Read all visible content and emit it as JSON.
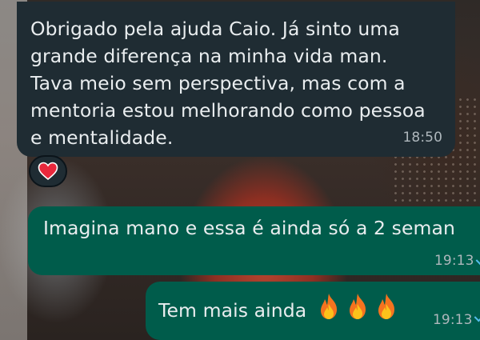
{
  "messages": [
    {
      "direction": "incoming",
      "text": "Obrigado pela ajuda Caio. Já sinto uma grande diferença na minha vida man. Tava meio sem perspectiva, mas com a mentoria estou melhorando como pessoa e mentalidade.",
      "time": "18:50",
      "reaction_icon": "heart-icon"
    },
    {
      "direction": "outgoing",
      "text": "Imagina mano e essa é ainda só a 2 seman",
      "time": "19:13",
      "status_icon": "read-check-icon"
    },
    {
      "direction": "outgoing",
      "text": "Tem mais ainda",
      "emoji_icons": [
        "fire-icon",
        "fire-icon",
        "fire-icon"
      ],
      "time": "19:13",
      "status_icon": "read-check-icon"
    }
  ],
  "colors": {
    "incoming_bubble": "#1f2c33",
    "outgoing_bubble": "#005c4b",
    "text": "#e9edef",
    "timestamp": "#aeb7bc",
    "read_check": "#53bdeb"
  }
}
